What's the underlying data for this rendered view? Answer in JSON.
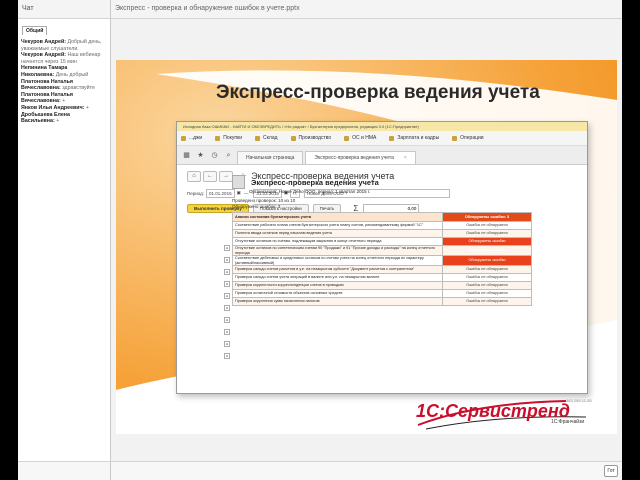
{
  "chat": {
    "title": "Чат",
    "tab": "Общий",
    "messages": [
      {
        "who": "Чекуров Андрей:",
        "text": "Добрый день, уважаемые слушатели."
      },
      {
        "who": "Чекуров Андрей:",
        "text": "Наш вебинар начнется через 15 мин"
      },
      {
        "who": "Непинина Тамара",
        "text": ""
      },
      {
        "who": "Николаевна:",
        "text": "День добрый"
      },
      {
        "who": "Платонова Наталья",
        "text": ""
      },
      {
        "who": "Вячеславовна:",
        "text": "здравствуйте"
      },
      {
        "who": "Платонова Наталья",
        "text": ""
      },
      {
        "who": "Вячеславовна:",
        "text": "+"
      },
      {
        "who": "Янков Илья Андреевич:",
        "text": "+"
      },
      {
        "who": "Дробышева Елена",
        "text": ""
      },
      {
        "who": "Васильевна:",
        "text": "+"
      }
    ]
  },
  "share": {
    "title": "Экспресс - проверка и обнаружение ошибок в учете.pptx",
    "ready_label": "Гот"
  },
  "slide": {
    "title": "Экспресс-проверка ведения учета",
    "app": {
      "window_title": "Исходная база ОШИБКИ - НАЙТИ И ОБЕЗВРЕДИТЬ / «Ни рядом» / Бухгалтерия предприятия, редакция 3.0 (1С:Предприятие)",
      "sections": [
        "...джи",
        "Покупки",
        "Склад",
        "Производство",
        "ОС и НМА",
        "Зарплата и кадры",
        "Операции"
      ],
      "tabs": [
        "Начальная страница",
        "Экспресс-проверка ведения учета"
      ],
      "form_title": "Экспресс-проверка ведения учета",
      "period_label": "Период:",
      "date_from": "01.01.2015",
      "date_to": "31.03.2015",
      "org_value": "Новое Дело ООО",
      "run_button": "Выполнить проверку",
      "settings_button": "Показать настройки",
      "print_button": "Печать",
      "sum_value": "0,00",
      "report": {
        "title": "Экспресс-проверка ведения учета",
        "subtitle": "Организация: Новое Дело ООО, период: 1 квартал 2015 г.",
        "checked": "Проведено проверок: 10 из 10",
        "errors": "Обнаружено ошибок: 3",
        "header": {
          "name": "Анализ состояния бухгалтерского учета",
          "status": "Обнаружены ошибки: 3"
        },
        "rows": [
          {
            "name": "Соответствие рабочего плана счетов бухгалтерского учета плану счетов, рекомендованному фирмой \"1С\"",
            "status": "Ошибок не обнаружено"
          },
          {
            "name": "Полнота ввода остатков перед началом ведения учета",
            "status": "Ошибок не обнаружено"
          },
          {
            "name": "Отсутствие остатков по счетам, подлежащим закрытию в конце отчетного периода",
            "status": "Обнаружены ошибки"
          },
          {
            "name": "Отсутствие остатков по синтетическим счетам 90 \"Продажи\" и 91 \"Прочие доходы и расходы\" на конец отчетного периода",
            "status": "Обнаружены ошибки"
          },
          {
            "name": "Соответствие дебетовых и кредитовых остатков по счетам учета на конец отчетного периода их характеру (активный/пассивный)",
            "status": "Обнаружены ошибки"
          },
          {
            "name": "Проверка сальдо счетов расчетов в у.е. на незакрытом субсчете \"Документ расчетов с контрагентом\"",
            "status": "Ошибок не обнаружено"
          },
          {
            "name": "Проверка сальдо счетов учета операций в валюте или у.е. на незакрытом валюте",
            "status": "Ошибок не обнаружено"
          },
          {
            "name": "Проверка корректности корреспонденции счетов в проводках",
            "status": "Ошибок не обнаружено"
          },
          {
            "name": "Проверка остаточной стоимости объектов основных средств",
            "status": "Ошибок не обнаружено"
          },
          {
            "name": "Проверка округления сумм начисления налогов",
            "status": "Ошибок не обнаружено"
          }
        ]
      }
    },
    "logo": {
      "text": "1С:Сервистренд",
      "sub": "1С:Франчайзи",
      "phone": "383 209-11-55"
    }
  },
  "colors": {
    "accent_orange": "#f39200",
    "error_red": "#e8411b",
    "button_yellow": "#f5d23f",
    "logo_red": "#c8102e"
  }
}
